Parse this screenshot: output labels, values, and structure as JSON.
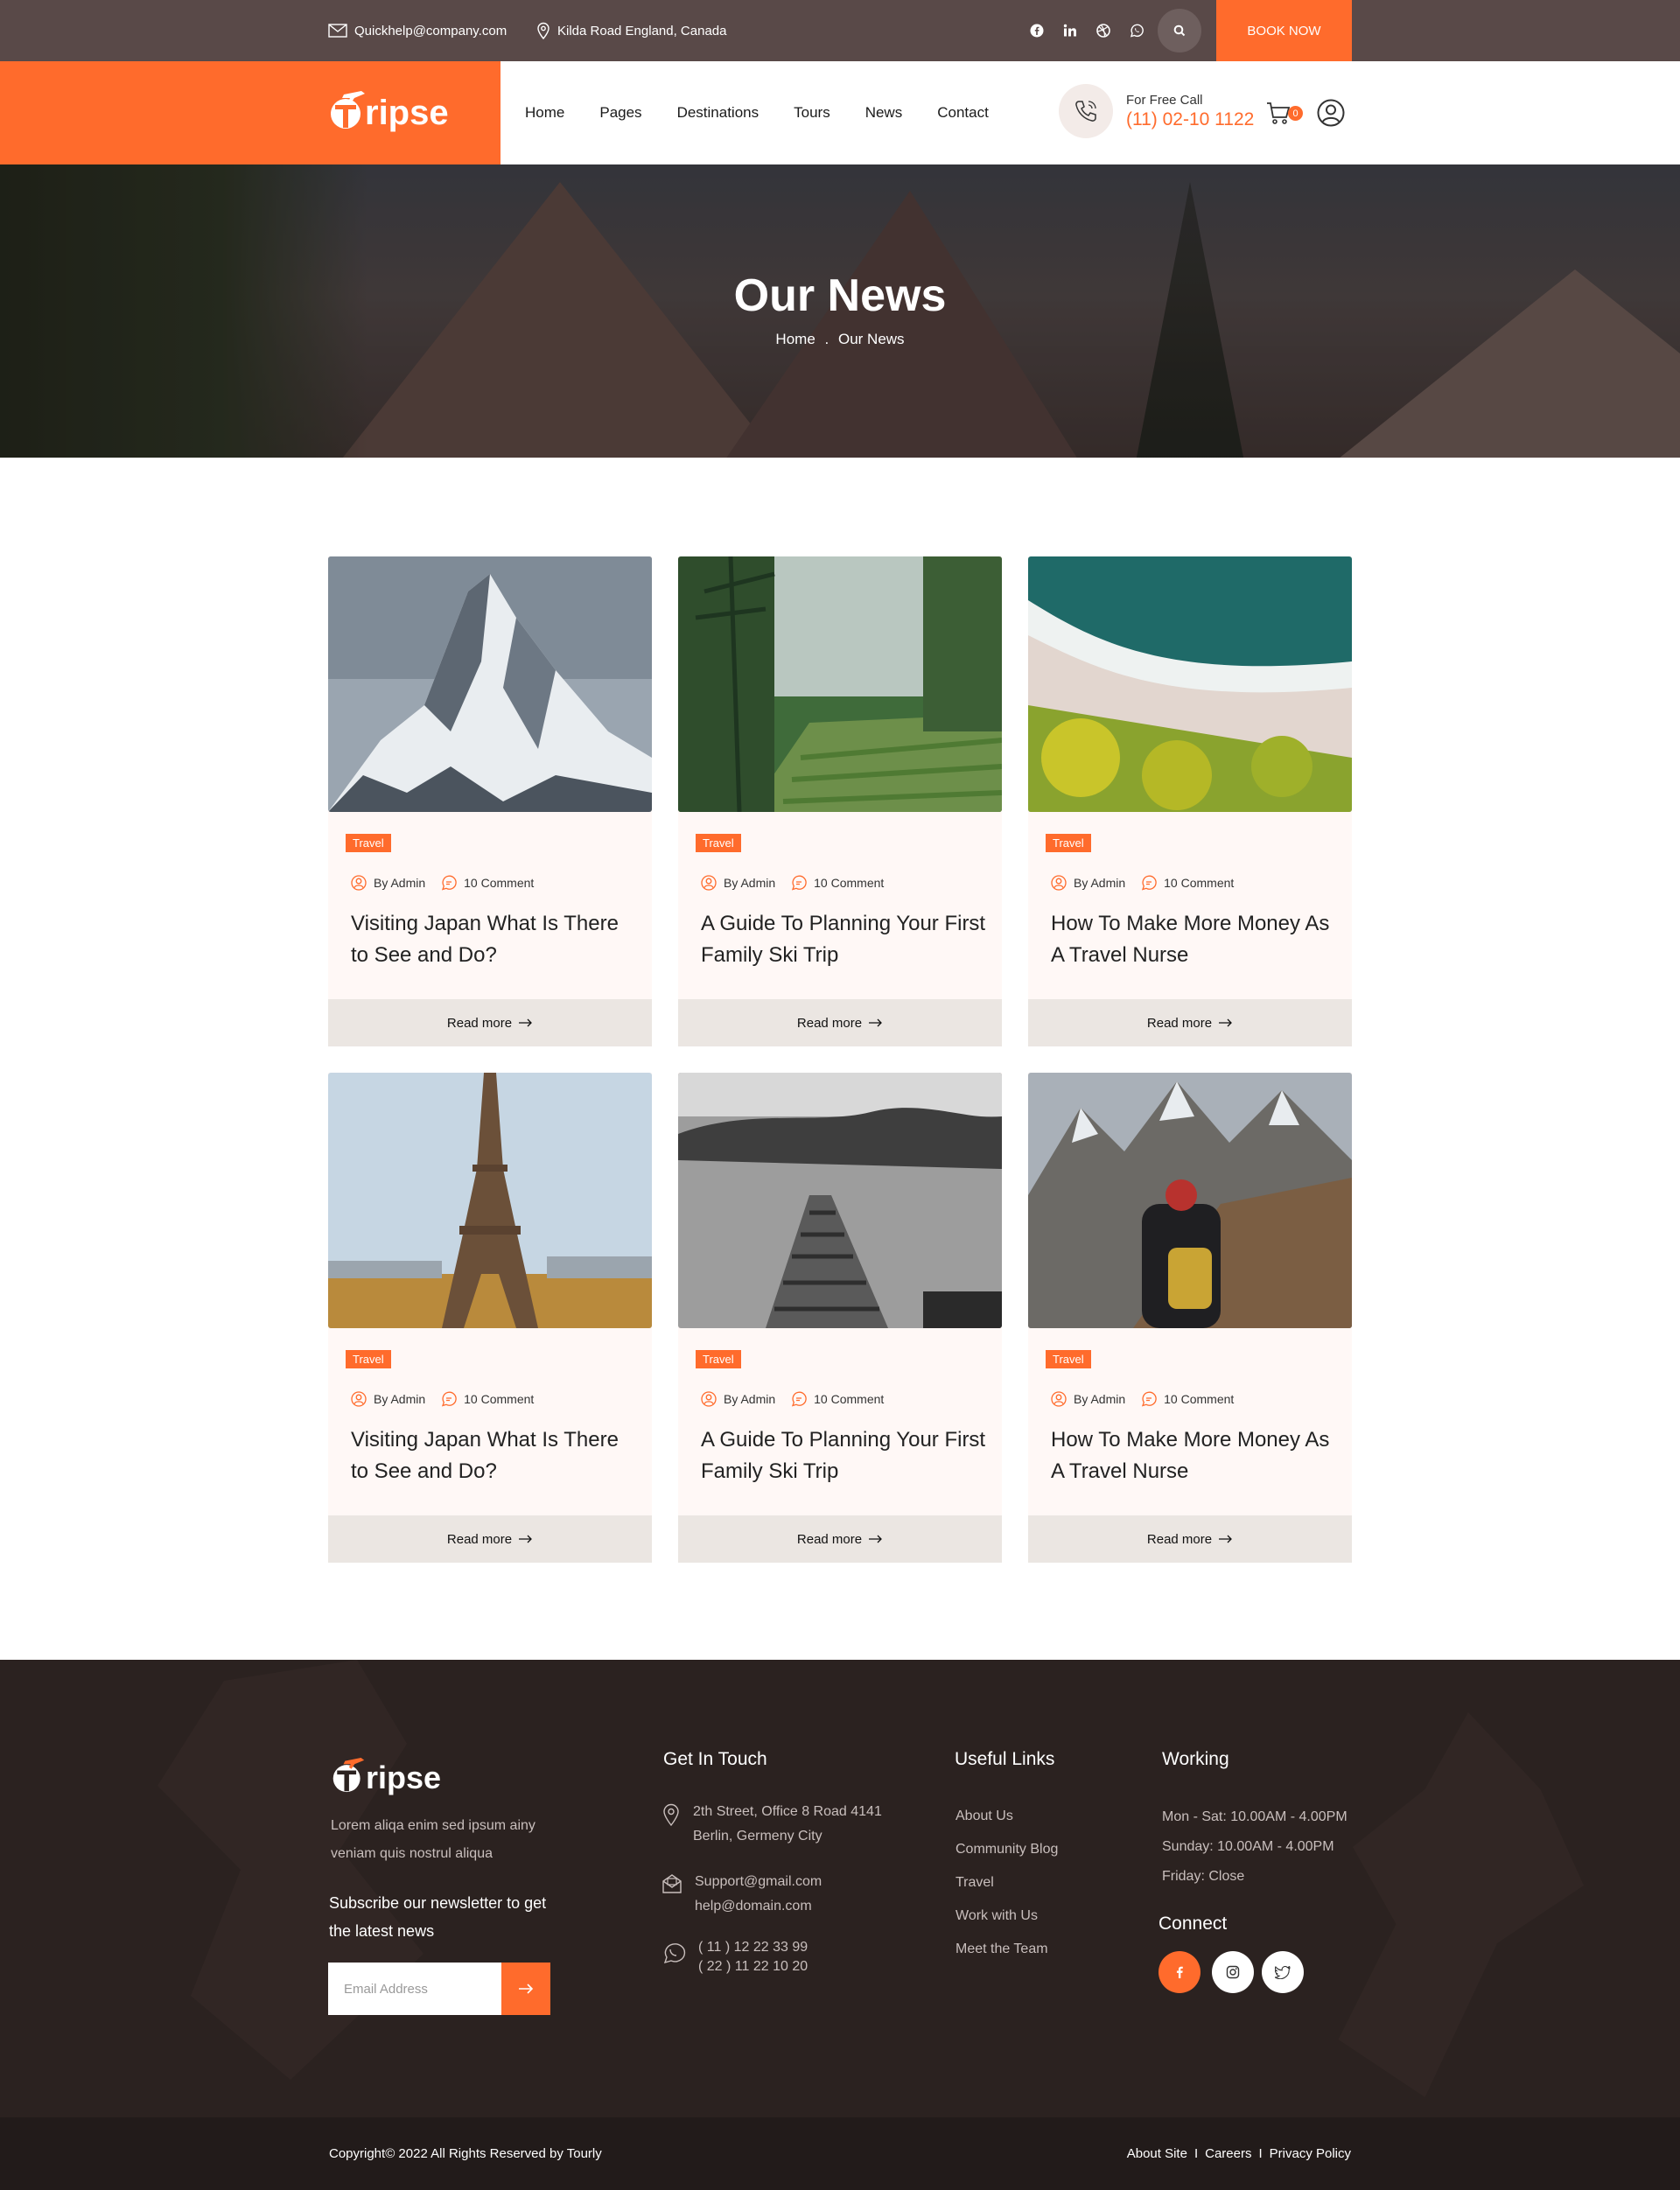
{
  "topbar": {
    "email": "Quickhelp@company.com",
    "address": "Kilda Road England, Canada",
    "socials": [
      "facebook-icon",
      "linkedin-icon",
      "dribbble-icon",
      "whatsapp-icon"
    ],
    "book_label": "BOOK NOW"
  },
  "header": {
    "logo": "ripse",
    "nav": [
      "Home",
      "Pages",
      "Destinations",
      "Tours",
      "News",
      "Contact"
    ],
    "call_label": "For Free Call",
    "call_number": "(11) 02-10 1122",
    "cart_count": "0"
  },
  "hero": {
    "title": "Our News",
    "crumb_home": "Home",
    "crumb_sep": ".",
    "crumb_current": "Our News"
  },
  "posts": [
    {
      "tag": "Travel",
      "author": "By Admin",
      "comments": "10 Comment",
      "title": "Visiting Japan What Is There to See and Do?",
      "more": "Read more",
      "image": "snowy-mountain"
    },
    {
      "tag": "Travel",
      "author": "By Admin",
      "comments": "10 Comment",
      "title": "A Guide To Planning Your First Family Ski Trip",
      "more": "Read more",
      "image": "rice-terraces"
    },
    {
      "tag": "Travel",
      "author": "By Admin",
      "comments": "10 Comment",
      "title": "How To Make More Money As A Travel Nurse",
      "more": "Read more",
      "image": "aerial-beach"
    },
    {
      "tag": "Travel",
      "author": "By Admin",
      "comments": "10 Comment",
      "title": "Visiting Japan What Is There to See and Do?",
      "more": "Read more",
      "image": "eiffel-tower"
    },
    {
      "tag": "Travel",
      "author": "By Admin",
      "comments": "10 Comment",
      "title": "A Guide To Planning Your First Family Ski Trip",
      "more": "Read more",
      "image": "wooden-pier"
    },
    {
      "tag": "Travel",
      "author": "By Admin",
      "comments": "10 Comment",
      "title": "How To Make More Money As A Travel Nurse",
      "more": "Read more",
      "image": "hiker-mountains"
    }
  ],
  "footer": {
    "logo": "ripse",
    "description": "Lorem aliqa enim sed ipsum ainy veniam quis nostrul aliqua",
    "subscribe": "Subscribe our newsletter to get the latest news",
    "email_placeholder": "Email Address",
    "touch_heading": "Get In Touch",
    "address_1": "2th Street, Office 8 Road 4141",
    "address_2": "Berlin, Germeny City",
    "mail_1": "Support@gmail.com",
    "mail_2": "help@domain.com",
    "phone_1": "( 11 ) 12 22 33 99",
    "phone_2": "( 22 ) 11 22 10 20",
    "links_heading": "Useful Links",
    "links": [
      "About Us",
      "Community Blog",
      "Travel",
      "Work with Us",
      "Meet the Team"
    ],
    "working_heading": "Working",
    "hours": [
      "Mon - Sat: 10.00AM - 4.00PM",
      "Sunday: 10.00AM - 4.00PM",
      "Friday: Close"
    ],
    "connect_heading": "Connect",
    "copyright": "Copyright© 2022 All Rights Reserved by Tourly",
    "bottom_links": [
      "About Site",
      "Careers",
      "Privacy Policy"
    ],
    "bottom_sep": "I"
  },
  "colors": {
    "accent": "#ff6b2c",
    "topbar": "#594948",
    "footer": "#2b2220"
  }
}
